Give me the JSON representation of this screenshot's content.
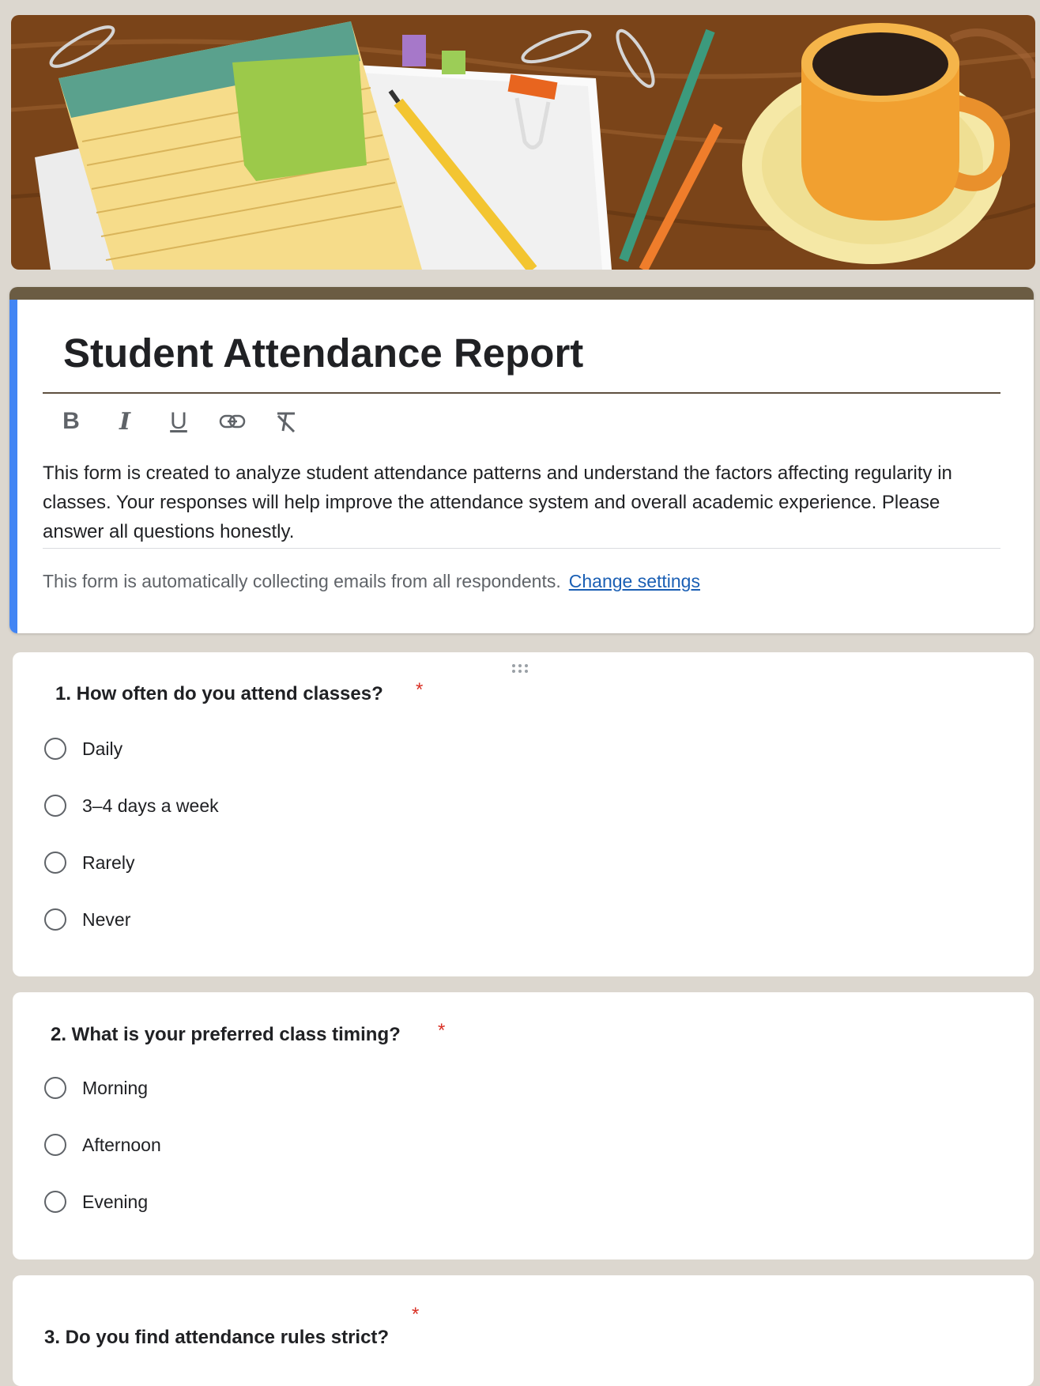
{
  "form": {
    "title": "Student Attendance Report",
    "description": "This form is created to analyze student attendance patterns and understand the factors affecting regularity in classes. Your responses will help improve the attendance system and overall academic experience. Please answer all questions honestly.",
    "email_note": "This form is automatically collecting emails from all respondents.",
    "change_settings_label": "Change settings"
  },
  "toolbar": {
    "bold": "B",
    "italic": "I",
    "underline": "U"
  },
  "questions": [
    {
      "title": "1. How often do you attend classes?",
      "required_marker": "*",
      "options": [
        "Daily",
        "3–4 days a week",
        "Rarely",
        "Never"
      ]
    },
    {
      "title": "2.  What is your preferred class timing?",
      "required_marker": "*",
      "options": [
        "Morning",
        "Afternoon",
        "Evening"
      ]
    },
    {
      "title": "3. Do you find attendance rules strict?",
      "required_marker": "*",
      "options": []
    }
  ],
  "colors": {
    "accent_left": "#4285f4",
    "header_bar": "#6b5c43",
    "required": "#d93025",
    "link": "#1a5fb4"
  },
  "icons": [
    "bold-icon",
    "italic-icon",
    "underline-icon",
    "link-icon",
    "clear-format-icon",
    "drag-handle-icon"
  ]
}
